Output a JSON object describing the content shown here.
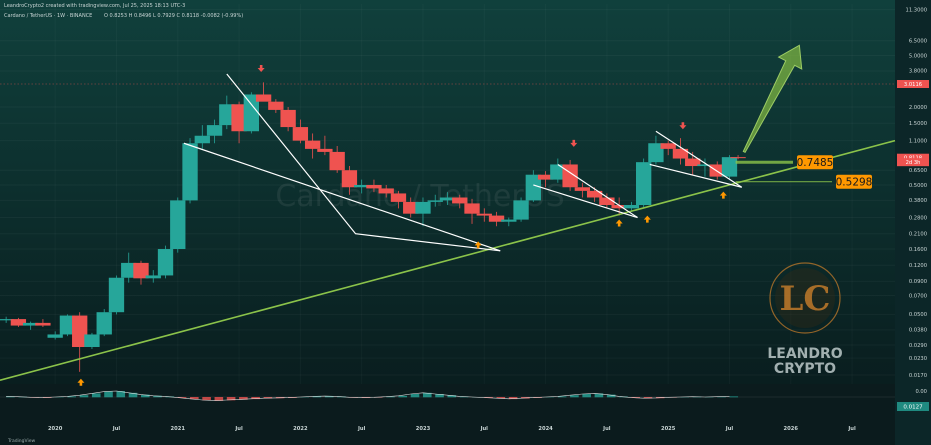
{
  "header": {
    "attribution": "LeandroCrypto2 created with tradingview.com, Jul 25, 2025 18:13 UTC-3",
    "symbol_line": "Cardano / TetherUS · 1W · BINANCE",
    "ohlc": "O 0.8253  H 0.8496  L 0.7929  C 0.8118  -0.0082 (-0.99%)"
  },
  "watermark": "Cardano / TetherUS",
  "logo": {
    "line1": "LEANDRO",
    "line2": "CRYPTO",
    "mark": "LC"
  },
  "footer_brand": "TradingView",
  "colors": {
    "background_top": "#10403c",
    "background_bottom": "#08181a",
    "up_candle": "#26a69a",
    "down_candle": "#ef5350",
    "trendline": "#8bc34a",
    "wedge_lines": "#ffffff",
    "arrow_up_marker": "#ff9800",
    "arrow_down_marker": "#ef5350",
    "label_orange": "#ff9800",
    "big_arrow": "#7cb342"
  },
  "chart_data": {
    "type": "candlestick",
    "scale": "log",
    "y_ticks": [
      "11.3000",
      "6.5000",
      "5.0000",
      "3.8000",
      "2.0000",
      "1.5000",
      "1.1000",
      "0.6500",
      "0.5000",
      "0.3800",
      "0.2800",
      "0.2100",
      "0.1600",
      "0.1200",
      "0.0900",
      "0.0700",
      "0.0500",
      "0.0380",
      "0.0290",
      "0.0230",
      "0.0170"
    ],
    "y_tick_values": [
      11.3,
      6.5,
      5.0,
      3.8,
      2.0,
      1.5,
      1.1,
      0.65,
      0.5,
      0.38,
      0.28,
      0.21,
      0.16,
      0.12,
      0.09,
      0.07,
      0.05,
      0.038,
      0.029,
      0.023,
      0.017
    ],
    "x_ticks": [
      "2020",
      "Jul",
      "2021",
      "Jul",
      "2022",
      "Jul",
      "2023",
      "Jul",
      "2024",
      "Jul",
      "2025",
      "Jul",
      "2026",
      "Jul"
    ],
    "x_tick_values": [
      2020.0,
      2020.5,
      2021.0,
      2021.5,
      2022.0,
      2022.5,
      2023.0,
      2023.5,
      2024.0,
      2024.5,
      2025.0,
      2025.5,
      2026.0,
      2026.5
    ],
    "ylim": [
      0.0145,
      12.5
    ],
    "xlim": [
      2019.55,
      2026.85
    ],
    "price_labels": [
      {
        "text": "3.0116",
        "value": 3.0116,
        "color": "#ef5350"
      },
      {
        "text": "0.8118",
        "value": 0.8118,
        "color": "#ef5350"
      },
      {
        "text": "2d 3h",
        "value": 0.75,
        "color": "#ef5350"
      }
    ],
    "levels": [
      {
        "label": "0.7485",
        "value": 0.7485
      },
      {
        "label": "0.5298",
        "value": 0.5298
      }
    ],
    "support_line": {
      "from": {
        "x": 2019.55,
        "y": 0.0155
      },
      "to": {
        "x": 2026.85,
        "y": 1.1
      }
    },
    "wedges": [
      {
        "upper": [
          [
            2021.4,
            3.6
          ],
          [
            2022.45,
            0.21
          ],
          [
            2023.63,
            0.155
          ]
        ],
        "lower": [
          [
            2021.05,
            1.05
          ],
          [
            2023.63,
            0.155
          ]
        ]
      },
      {
        "upper": [
          [
            2024.1,
            0.72
          ],
          [
            2024.75,
            0.28
          ]
        ],
        "lower": [
          [
            2023.9,
            0.5
          ],
          [
            2024.75,
            0.28
          ]
        ]
      },
      {
        "upper": [
          [
            2024.9,
            1.3
          ],
          [
            2025.6,
            0.48
          ]
        ],
        "lower": [
          [
            2024.85,
            0.72
          ],
          [
            2025.6,
            0.48
          ]
        ]
      }
    ],
    "markers_up": [
      {
        "x": 2020.21,
        "y": 0.0165
      },
      {
        "x": 2023.45,
        "y": 0.19
      },
      {
        "x": 2024.6,
        "y": 0.28
      },
      {
        "x": 2024.83,
        "y": 0.3
      },
      {
        "x": 2025.45,
        "y": 0.46
      }
    ],
    "markers_down": [
      {
        "x": 2021.68,
        "y": 3.6
      },
      {
        "x": 2024.23,
        "y": 0.95
      },
      {
        "x": 2025.12,
        "y": 1.3
      }
    ],
    "projection_arrow": {
      "from": {
        "x": 2025.62,
        "y": 0.9
      },
      "to": {
        "x": 2026.07,
        "y": 6.0
      }
    },
    "candles": [
      [
        2019.6,
        0.045,
        0.048,
        0.043,
        0.046
      ],
      [
        2019.7,
        0.046,
        0.047,
        0.04,
        0.041
      ],
      [
        2019.8,
        0.041,
        0.044,
        0.038,
        0.043
      ],
      [
        2019.9,
        0.043,
        0.046,
        0.04,
        0.041
      ],
      [
        2020.0,
        0.033,
        0.037,
        0.032,
        0.035
      ],
      [
        2020.1,
        0.035,
        0.05,
        0.034,
        0.049
      ],
      [
        2020.2,
        0.049,
        0.052,
        0.018,
        0.028
      ],
      [
        2020.3,
        0.028,
        0.036,
        0.027,
        0.035
      ],
      [
        2020.4,
        0.035,
        0.055,
        0.034,
        0.052
      ],
      [
        2020.5,
        0.052,
        0.1,
        0.05,
        0.096
      ],
      [
        2020.6,
        0.096,
        0.15,
        0.088,
        0.125
      ],
      [
        2020.7,
        0.125,
        0.13,
        0.085,
        0.095
      ],
      [
        2020.8,
        0.095,
        0.11,
        0.088,
        0.1
      ],
      [
        2020.9,
        0.1,
        0.17,
        0.095,
        0.16
      ],
      [
        2021.0,
        0.16,
        0.4,
        0.15,
        0.38
      ],
      [
        2021.1,
        0.38,
        1.15,
        0.36,
        1.05
      ],
      [
        2021.2,
        1.05,
        1.45,
        0.95,
        1.2
      ],
      [
        2021.3,
        1.2,
        1.6,
        1.05,
        1.45
      ],
      [
        2021.4,
        1.45,
        2.45,
        1.35,
        2.1
      ],
      [
        2021.5,
        2.1,
        2.2,
        1.05,
        1.3
      ],
      [
        2021.6,
        1.3,
        2.6,
        1.25,
        2.5
      ],
      [
        2021.7,
        2.5,
        3.1,
        2.3,
        2.2
      ],
      [
        2021.8,
        2.2,
        2.3,
        1.8,
        1.9
      ],
      [
        2021.9,
        1.9,
        2.0,
        1.3,
        1.4
      ],
      [
        2022.0,
        1.4,
        1.6,
        1.05,
        1.1
      ],
      [
        2022.1,
        1.1,
        1.25,
        0.8,
        0.95
      ],
      [
        2022.2,
        0.95,
        1.2,
        0.85,
        0.9
      ],
      [
        2022.3,
        0.9,
        1.0,
        0.62,
        0.65
      ],
      [
        2022.4,
        0.65,
        0.7,
        0.42,
        0.48
      ],
      [
        2022.5,
        0.48,
        0.55,
        0.43,
        0.5
      ],
      [
        2022.6,
        0.5,
        0.55,
        0.44,
        0.47
      ],
      [
        2022.7,
        0.47,
        0.5,
        0.4,
        0.43
      ],
      [
        2022.8,
        0.43,
        0.45,
        0.33,
        0.37
      ],
      [
        2022.9,
        0.37,
        0.4,
        0.28,
        0.3
      ],
      [
        2023.0,
        0.3,
        0.4,
        0.24,
        0.37
      ],
      [
        2023.1,
        0.37,
        0.42,
        0.34,
        0.38
      ],
      [
        2023.2,
        0.38,
        0.44,
        0.35,
        0.4
      ],
      [
        2023.3,
        0.4,
        0.42,
        0.33,
        0.36
      ],
      [
        2023.4,
        0.36,
        0.39,
        0.25,
        0.3
      ],
      [
        2023.5,
        0.3,
        0.33,
        0.26,
        0.29
      ],
      [
        2023.6,
        0.29,
        0.31,
        0.24,
        0.26
      ],
      [
        2023.7,
        0.26,
        0.28,
        0.24,
        0.27
      ],
      [
        2023.8,
        0.27,
        0.4,
        0.26,
        0.38
      ],
      [
        2023.9,
        0.38,
        0.65,
        0.37,
        0.6
      ],
      [
        2024.0,
        0.6,
        0.64,
        0.48,
        0.55
      ],
      [
        2024.1,
        0.55,
        0.8,
        0.52,
        0.72
      ],
      [
        2024.2,
        0.72,
        0.78,
        0.45,
        0.48
      ],
      [
        2024.3,
        0.48,
        0.52,
        0.4,
        0.45
      ],
      [
        2024.4,
        0.45,
        0.48,
        0.37,
        0.4
      ],
      [
        2024.5,
        0.4,
        0.43,
        0.33,
        0.35
      ],
      [
        2024.6,
        0.35,
        0.4,
        0.29,
        0.33
      ],
      [
        2024.7,
        0.33,
        0.37,
        0.31,
        0.35
      ],
      [
        2024.8,
        0.35,
        0.8,
        0.33,
        0.75
      ],
      [
        2024.9,
        0.75,
        1.2,
        0.72,
        1.05
      ],
      [
        2025.0,
        1.05,
        1.1,
        0.85,
        0.95
      ],
      [
        2025.1,
        0.95,
        1.15,
        0.72,
        0.8
      ],
      [
        2025.2,
        0.8,
        0.9,
        0.6,
        0.7
      ],
      [
        2025.3,
        0.7,
        0.8,
        0.58,
        0.72
      ],
      [
        2025.4,
        0.72,
        0.76,
        0.55,
        0.58
      ],
      [
        2025.5,
        0.58,
        0.85,
        0.55,
        0.82
      ],
      [
        2025.57,
        0.82,
        0.85,
        0.79,
        0.81
      ]
    ],
    "oscillator": {
      "zero_label": "0.00",
      "value_label": "0.0127",
      "values": [
        0.1,
        0.05,
        -0.05,
        -0.1,
        0.0,
        0.1,
        0.3,
        0.6,
        0.9,
        1.0,
        0.7,
        0.4,
        0.2,
        0.1,
        -0.1,
        -0.3,
        -0.5,
        -0.6,
        -0.5,
        -0.4,
        -0.3,
        -0.2,
        -0.15,
        -0.1,
        0.0,
        0.1,
        0.15,
        0.1,
        -0.05,
        -0.1,
        -0.05,
        0.05,
        0.2,
        0.5,
        0.7,
        0.5,
        0.3,
        0.1,
        0.0,
        -0.1,
        -0.2,
        -0.3,
        -0.2,
        -0.1,
        0.0,
        0.1,
        0.3,
        0.5,
        0.6,
        0.4,
        0.1,
        -0.1,
        -0.2,
        -0.15,
        -0.05,
        0.0,
        0.05,
        0.0,
        0.05,
        0.1
      ]
    }
  }
}
